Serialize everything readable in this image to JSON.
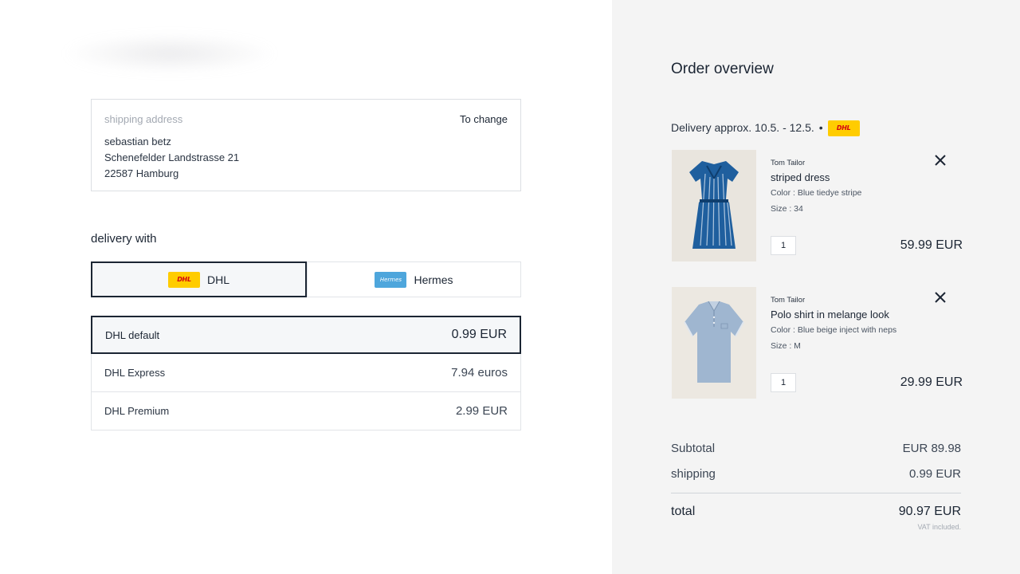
{
  "shipping_address": {
    "label": "shipping address",
    "change_label": "To change",
    "name": "sebastian betz",
    "street": "Schenefelder Landstrasse 21",
    "city": "22587 Hamburg"
  },
  "delivery": {
    "heading": "delivery with",
    "carriers": [
      {
        "label": "DHL",
        "logo_text": "DHL",
        "icon": "dhl-logo",
        "selected": true
      },
      {
        "label": "Hermes",
        "logo_text": "Hermes",
        "icon": "hermes-logo",
        "selected": false
      }
    ],
    "options": [
      {
        "label": "DHL default",
        "price": "0.99 EUR",
        "selected": true
      },
      {
        "label": "DHL Express",
        "price": "7.94 euros",
        "selected": false
      },
      {
        "label": "DHL Premium",
        "price": "2.99 EUR",
        "selected": false
      }
    ]
  },
  "order": {
    "title": "Order overview",
    "delivery_estimate": "Delivery approx. 10.5. - 12.5.",
    "separator": "•",
    "carrier_logo_text": "DHL",
    "items": [
      {
        "brand": "Tom Tailor",
        "name": "striped dress",
        "color": "Color : Blue tiedye stripe",
        "size": "Size : 34",
        "quantity": "1",
        "price": "59.99 EUR",
        "image": "striped-dress-image"
      },
      {
        "brand": "Tom Tailor",
        "name": "Polo shirt in melange look",
        "color": "Color : Blue beige inject with neps",
        "size": "Size : M",
        "quantity": "1",
        "price": "29.99 EUR",
        "image": "polo-shirt-image"
      }
    ],
    "summary": {
      "subtotal_label": "Subtotal",
      "subtotal_value": "EUR 89.98",
      "shipping_label": "shipping",
      "shipping_value": "0.99 EUR",
      "total_label": "total",
      "total_value": "90.97 EUR",
      "vat_note": "VAT included."
    }
  },
  "colors": {
    "text": "#1b2533",
    "right_pane_bg": "#f4f4f4",
    "dhl_yellow": "#ffcc00",
    "dhl_red": "#d40511",
    "hermes_blue": "#4ea6dc"
  }
}
